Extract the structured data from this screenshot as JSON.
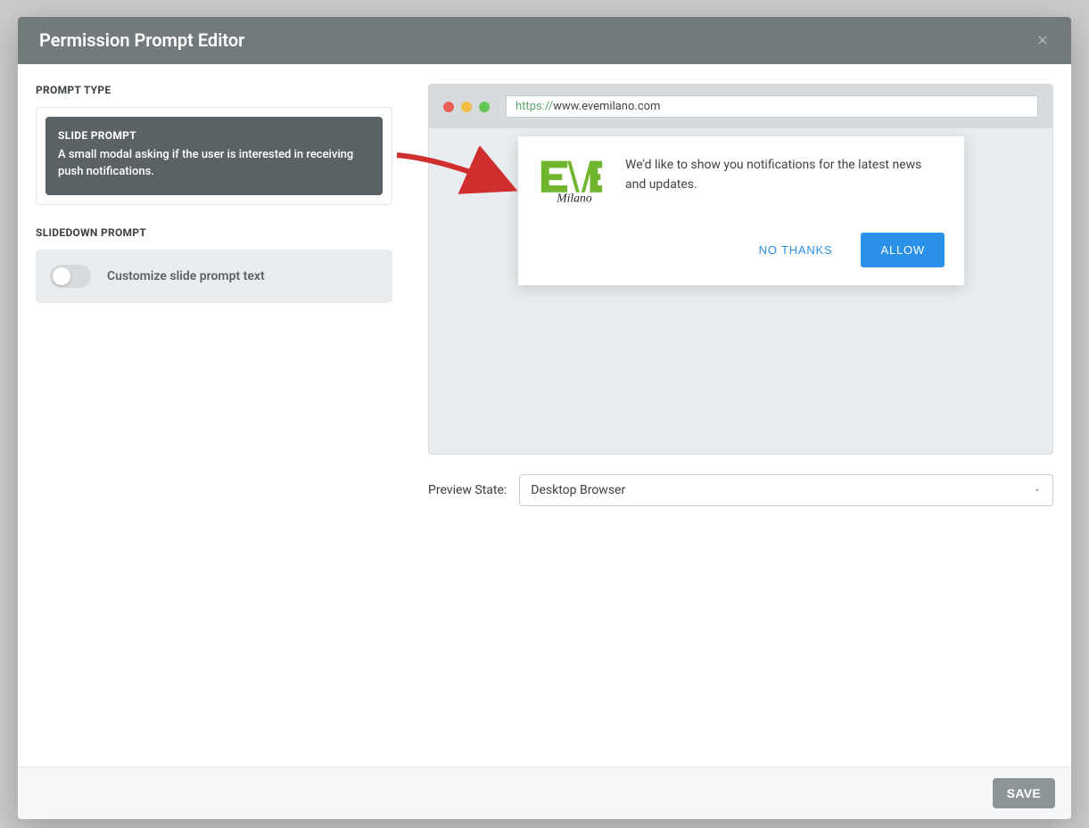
{
  "modal": {
    "title": "Permission Prompt Editor"
  },
  "left": {
    "prompt_type_label": "PROMPT TYPE",
    "slide_prompt": {
      "title": "SLIDE PROMPT",
      "desc": "A small modal asking if the user is interested in receiving push notifications."
    },
    "slidedown_label": "SLIDEDOWN PROMPT",
    "toggle_label": "Customize slide prompt text"
  },
  "preview": {
    "url_https": "https://",
    "url_rest": "www.evemilano.com",
    "notify_text": "We'd like to show you notifications for the latest news and updates.",
    "no_thanks": "NO THANKS",
    "allow": "ALLOW",
    "state_label": "Preview State:",
    "state_value": "Desktop Browser",
    "logo_text": "Milano"
  },
  "footer": {
    "save": "SAVE"
  }
}
